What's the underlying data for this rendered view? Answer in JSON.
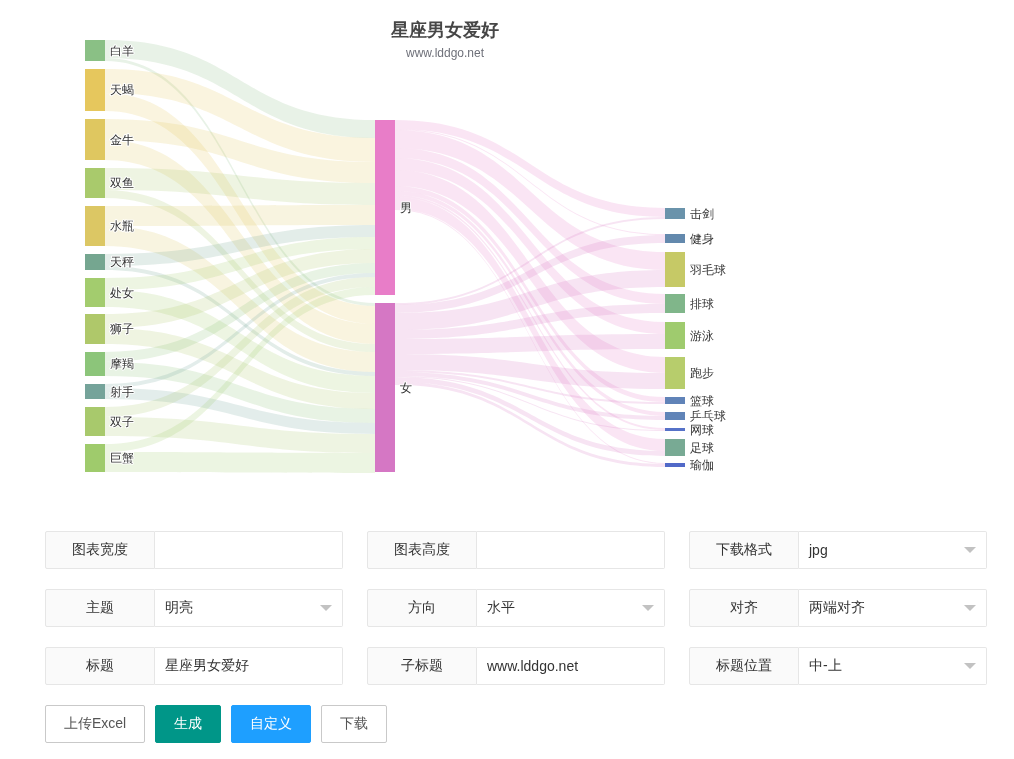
{
  "chart": {
    "title": "星座男女爱好",
    "subtitle": "www.lddgo.net",
    "left_nodes": [
      {
        "label": "白羊",
        "color": "#8ac085"
      },
      {
        "label": "天蝎",
        "color": "#e6c75d"
      },
      {
        "label": "金牛",
        "color": "#dfc760"
      },
      {
        "label": "双鱼",
        "color": "#a9ca6c"
      },
      {
        "label": "水瓶",
        "color": "#dcc764"
      },
      {
        "label": "天秤",
        "color": "#75a690"
      },
      {
        "label": "处女",
        "color": "#a3cc6e"
      },
      {
        "label": "狮子",
        "color": "#afc86a"
      },
      {
        "label": "摩羯",
        "color": "#8cc57a"
      },
      {
        "label": "射手",
        "color": "#75a39a"
      },
      {
        "label": "双子",
        "color": "#a8c96c"
      },
      {
        "label": "巨蟹",
        "color": "#9fcb6c"
      }
    ],
    "middle_nodes": [
      {
        "label": "男",
        "color": "#e87dc8"
      },
      {
        "label": "女",
        "color": "#d577c4"
      }
    ],
    "right_nodes": [
      {
        "label": "击剑",
        "color": "#6a93ab"
      },
      {
        "label": "健身",
        "color": "#6389ad"
      },
      {
        "label": "羽毛球",
        "color": "#c6c966"
      },
      {
        "label": "排球",
        "color": "#80b68a"
      },
      {
        "label": "游泳",
        "color": "#9fcb6e"
      },
      {
        "label": "跑步",
        "color": "#b7cd6c"
      },
      {
        "label": "篮球",
        "color": "#6083b8"
      },
      {
        "label": "乒乓球",
        "color": "#6084b8"
      },
      {
        "label": "网球",
        "color": "#5672c8"
      },
      {
        "label": "足球",
        "color": "#78aa94"
      },
      {
        "label": "瑜伽",
        "color": "#5169c8"
      }
    ]
  },
  "settings": [
    {
      "kind": "input",
      "label": "图表宽度"
    },
    {
      "kind": "input",
      "label": "图表高度"
    },
    {
      "kind": "select",
      "label": "下载格式",
      "value": "jpg"
    },
    {
      "kind": "select",
      "label": "主题",
      "value": "明亮"
    },
    {
      "kind": "select",
      "label": "方向",
      "value": "水平"
    },
    {
      "kind": "select",
      "label": "对齐",
      "value": "两端对齐"
    },
    {
      "kind": "input",
      "label": "标题",
      "value": "星座男女爱好"
    },
    {
      "kind": "input",
      "label": "子标题",
      "value": "www.lddgo.net"
    },
    {
      "kind": "select",
      "label": "标题位置",
      "value": "中-上"
    }
  ],
  "buttons": [
    {
      "label": "上传Excel",
      "kind": "plain"
    },
    {
      "label": "生成",
      "kind": "default"
    },
    {
      "label": "自定义",
      "kind": "normal"
    },
    {
      "label": "下载",
      "kind": "plain"
    }
  ]
}
